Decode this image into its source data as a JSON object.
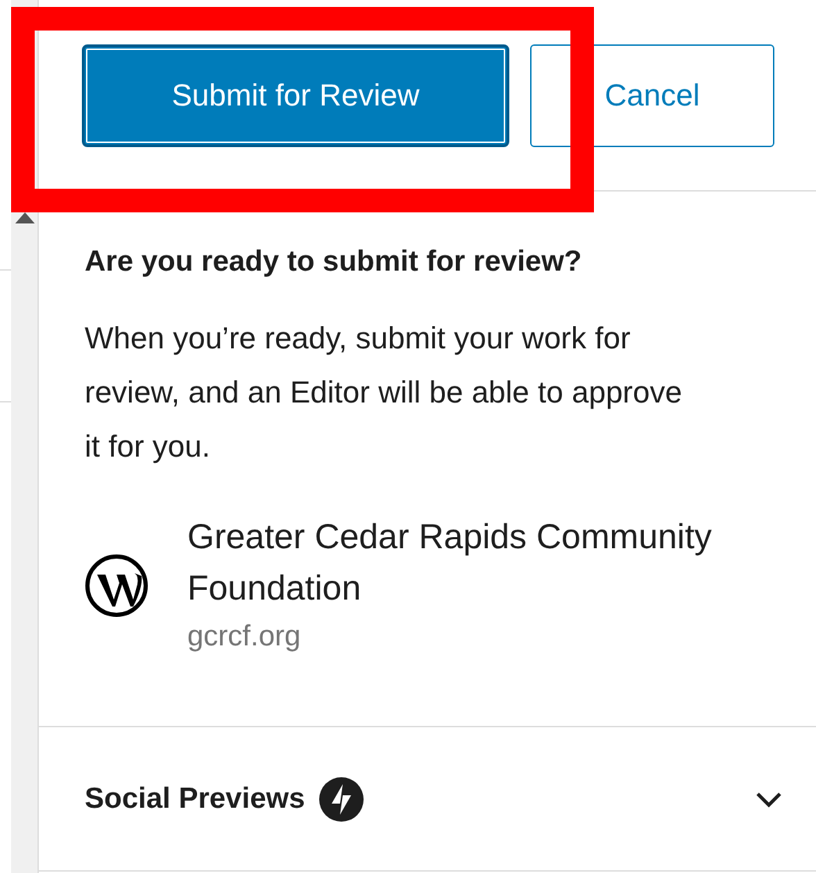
{
  "buttons": [
    {
      "label": "Submit for Review",
      "kind": "primary"
    },
    {
      "label": "Cancel",
      "kind": "secondary"
    }
  ],
  "heading": "Are you ready to submit for review?",
  "message": "When you’re ready, submit your work for review, and an Editor will be able to approve it for you.",
  "site": {
    "name": "Greater Cedar Rapids Community Foundation",
    "url": "gcrcf.org"
  },
  "panels": [
    {
      "title": "Social Previews",
      "expanded": false
    }
  ]
}
